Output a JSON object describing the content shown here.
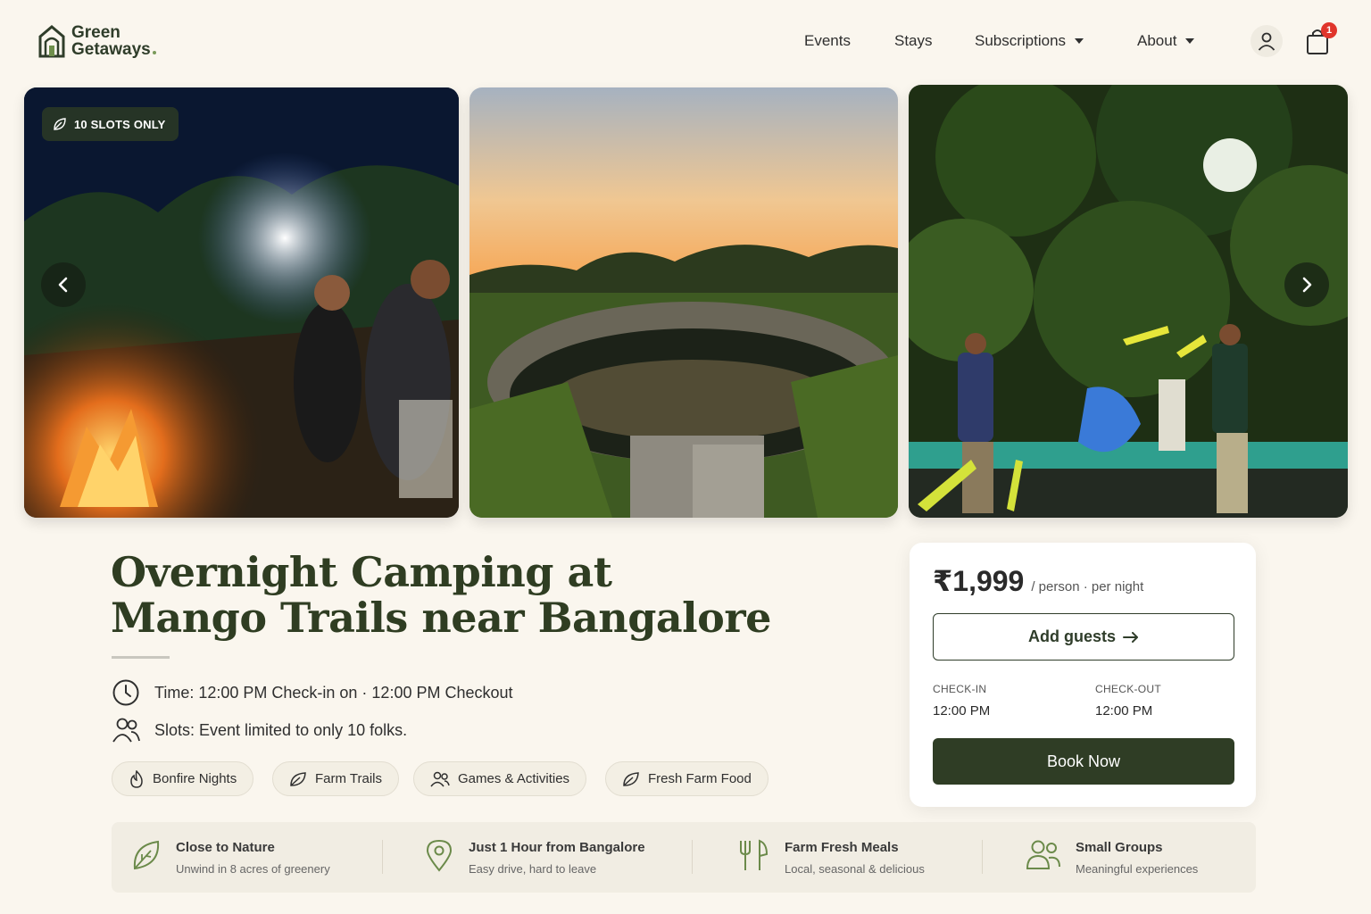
{
  "brand": {
    "line1": "Green",
    "line2": "Getaways"
  },
  "nav": {
    "events": "Events",
    "stays": "Stays",
    "subscriptions": "Subscriptions",
    "about": "About"
  },
  "cart": {
    "count": "1"
  },
  "gallery": {
    "badge": "10 SLOTS ONLY",
    "images": [
      "bonfire-night-photo",
      "farm-pond-sunset-photo",
      "games-activities-photo"
    ]
  },
  "event": {
    "title_line1": "Overnight Camping at",
    "title_line2": "Mango Trails near Bangalore",
    "time": "Time: 12:00 PM Check-in on · 12:00 PM Checkout",
    "slots": "Slots: Event limited to only 10 folks."
  },
  "chips": [
    "Bonfire Nights",
    "Farm Trails",
    "Games & Activities",
    "Fresh Farm Food"
  ],
  "booking": {
    "price": "₹1,999",
    "unit": "/ person · per night",
    "add_guests": "Add guests",
    "checkin_label": "CHECK-IN",
    "checkin_value": "12:00 PM",
    "checkout_label": "CHECK-OUT",
    "checkout_value": "12:00 PM",
    "book_now": "Book Now"
  },
  "features": [
    {
      "title": "Close to Nature",
      "sub": "Unwind in 8 acres of greenery",
      "icon": "leaf-icon"
    },
    {
      "title": "Just 1 Hour from Bangalore",
      "sub": "Easy drive, hard to leave",
      "icon": "location-pin-icon"
    },
    {
      "title": "Farm Fresh Meals",
      "sub": "Local, seasonal & delicious",
      "icon": "fork-knife-icon"
    },
    {
      "title": "Small Groups",
      "sub": "Meaningful experiences",
      "icon": "people-icon"
    }
  ],
  "colors": {
    "background": "#faf6ee",
    "brand_dark_green": "#2f3d25",
    "title_green": "#2f3d22",
    "badge_red": "#e0352b"
  }
}
